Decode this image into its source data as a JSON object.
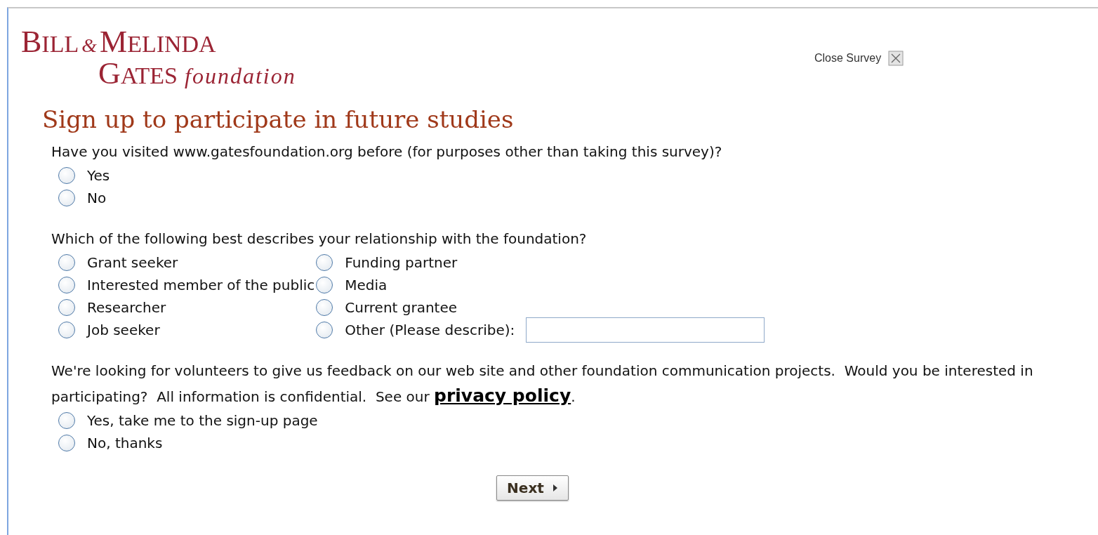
{
  "logo": {
    "first": "BILL",
    "ampersand": "&",
    "second": "MELINDA",
    "third": "GATES",
    "tagline": "foundation"
  },
  "close_survey": {
    "label": "Close Survey"
  },
  "title": "Sign up to participate in future studies",
  "questions": [
    {
      "kind": "list",
      "prompt": "Have you visited www.gatesfoundation.org before (for purposes other than taking this survey)?",
      "options": [
        {
          "label": "Yes",
          "selected": false,
          "kind": "plain"
        },
        {
          "label": "No",
          "selected": false,
          "kind": "plain"
        }
      ]
    },
    {
      "kind": "grid",
      "prompt": "Which of the following best describes your relationship with the foundation?",
      "options": [
        {
          "label": "Grant seeker",
          "selected": false,
          "kind": "plain"
        },
        {
          "label": "Funding partner",
          "selected": false,
          "kind": "plain"
        },
        {
          "label": "Interested member of the public",
          "selected": false,
          "kind": "plain"
        },
        {
          "label": "Media",
          "selected": false,
          "kind": "plain"
        },
        {
          "label": "Researcher",
          "selected": false,
          "kind": "plain"
        },
        {
          "label": "Current grantee",
          "selected": false,
          "kind": "plain"
        },
        {
          "label": "Job seeker",
          "selected": false,
          "kind": "plain"
        },
        {
          "label": "Other (Please describe):",
          "selected": false,
          "kind": "other"
        }
      ]
    },
    {
      "kind": "list",
      "prompt": "We're looking for volunteers to give us feedback on our web site and other foundation communication projects.  Would you be interested in participating?  All information is confidential.  See our",
      "link": "privacy policy",
      "prompt_end": ".",
      "options": [
        {
          "label": "Yes, take me to the sign-up page",
          "selected": false,
          "kind": "plain"
        },
        {
          "label": "No, thanks",
          "selected": false,
          "kind": "plain"
        }
      ]
    }
  ],
  "next_button": {
    "label": "Next"
  }
}
